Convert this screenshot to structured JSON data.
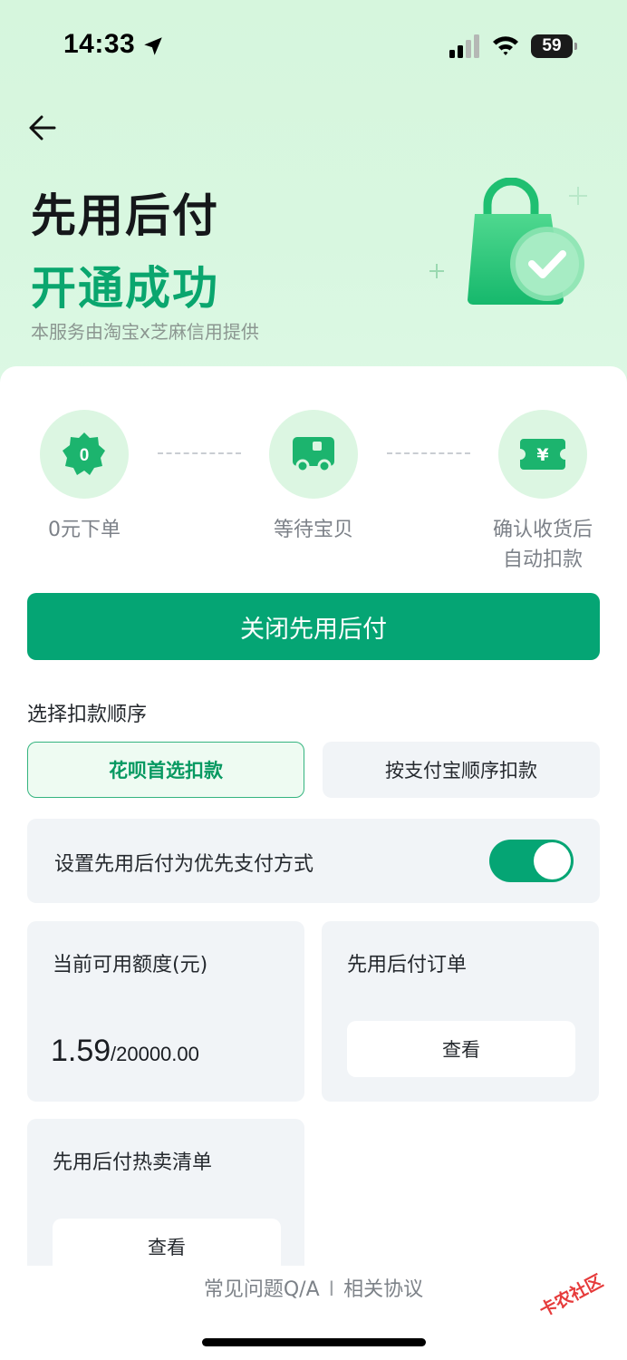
{
  "status_bar": {
    "time": "14:33",
    "battery": "59"
  },
  "hero": {
    "title": "先用后付",
    "subtitle": "开通成功",
    "note": "本服务由淘宝x芝麻信用提供"
  },
  "steps": [
    {
      "label": "0元下单",
      "icon": "zero-badge-icon",
      "icon_text": "0"
    },
    {
      "label": "等待宝贝",
      "icon": "truck-icon"
    },
    {
      "label_line1": "确认收货后",
      "label_line2": "自动扣款",
      "icon": "ticket-yen-icon",
      "icon_text": "¥"
    }
  ],
  "primary_button": "关闭先用后付",
  "deduction_order": {
    "label": "选择扣款顺序",
    "options": [
      "花呗首选扣款",
      "按支付宝顺序扣款"
    ],
    "selected": "花呗首选扣款"
  },
  "preference": {
    "label": "设置先用后付为优先支付方式",
    "enabled": true
  },
  "quota": {
    "title": "当前可用额度(元)",
    "available": "1.59",
    "total": "/20000.00"
  },
  "orders": {
    "title": "先用后付订单",
    "button": "查看"
  },
  "hot_list": {
    "title": "先用后付热卖清单",
    "button": "查看"
  },
  "footer": {
    "faq": "常见问题Q/A",
    "separator": "I",
    "agreement": "相关协议"
  },
  "watermark": "卡农社区",
  "colors": {
    "accent": "#05a574",
    "hero_bg": "#d6f6dd",
    "tile_bg": "#f1f4f7"
  }
}
